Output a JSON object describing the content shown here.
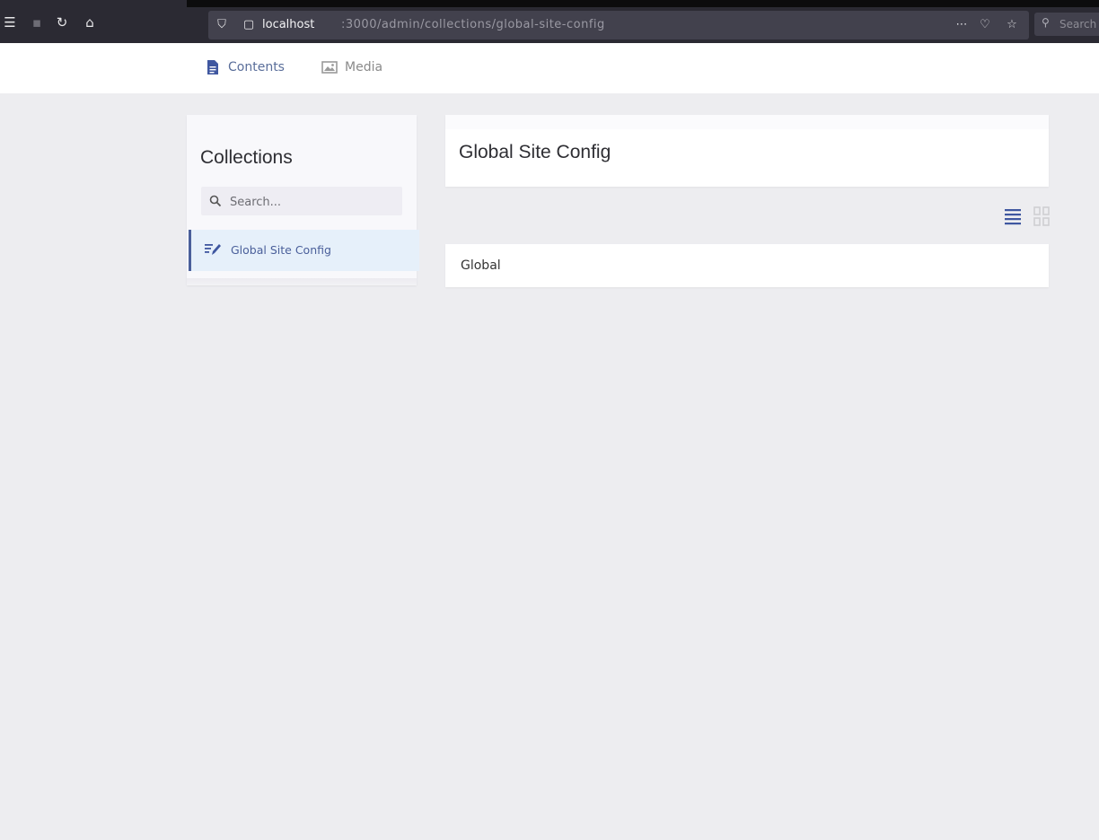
{
  "browser": {
    "url_host": "localhost",
    "url_path": ":3000/admin/collections/global-site-config",
    "search_placeholder": "Search",
    "icons": {
      "menu": "sidebar-icon",
      "reload": "reload-icon",
      "home": "home-icon",
      "shield": "shield-icon",
      "page": "page-icon",
      "ext": "extensions-icon",
      "pocket": "pocket-icon",
      "star": "star-icon",
      "search": "search-icon"
    }
  },
  "nav": {
    "contents_label": "Contents",
    "media_label": "Media"
  },
  "sidebar": {
    "title": "Collections",
    "search_placeholder": "Search...",
    "items": [
      {
        "label": "Global Site Config",
        "active": true
      }
    ]
  },
  "main": {
    "title": "Global Site Config",
    "view_modes": [
      "list",
      "grid"
    ],
    "active_view": "list",
    "entries": [
      {
        "label": "Global"
      }
    ]
  },
  "colors": {
    "accent": "#3f57a0",
    "background": "#ededf0",
    "active_item_bg": "#e6f0fa",
    "chrome": "#2b2a33"
  }
}
